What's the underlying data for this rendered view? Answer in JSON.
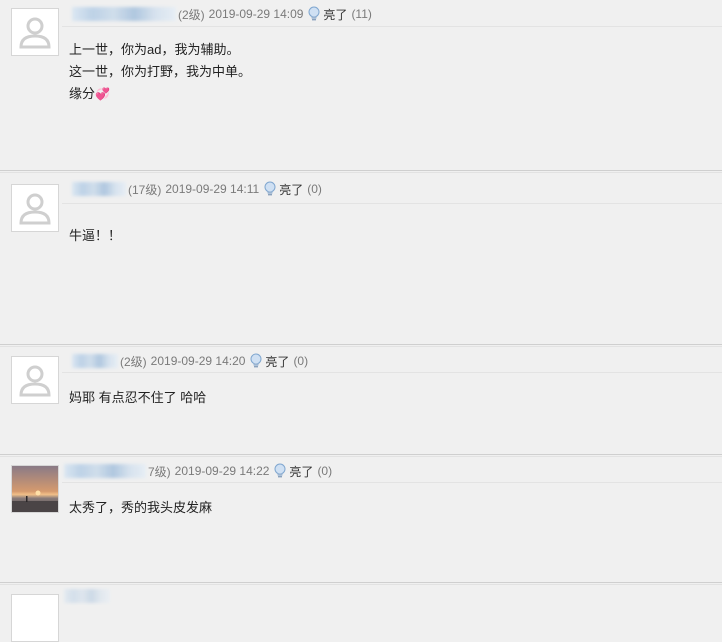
{
  "comments": [
    {
      "level": "(2级)",
      "time": "2019-09-29 14:09",
      "like_label": "亮了",
      "like_count": "(11)",
      "lines": [
        "上一世，你为ad，我为辅助。",
        "这一世，你为打野，我为中单。",
        "缘分"
      ],
      "emoji": "💞",
      "avatar": "default-avatar"
    },
    {
      "level": "(17级)",
      "time": "2019-09-29 14:11",
      "like_label": "亮了",
      "like_count": "(0)",
      "lines": [
        "牛逼！！"
      ],
      "avatar": "default-avatar"
    },
    {
      "level": "(2级)",
      "time": "2019-09-29 14:20",
      "like_label": "亮了",
      "like_count": "(0)",
      "lines": [
        "妈耶 有点忍不住了 哈哈"
      ],
      "avatar": "default-avatar"
    },
    {
      "level": "7级)",
      "time": "2019-09-29 14:22",
      "like_label": "亮了",
      "like_count": "(0)",
      "lines": [
        "太秀了，秀的我头皮发麻"
      ],
      "avatar": "sunset-photo-avatar"
    }
  ],
  "colors": {
    "background": "#f0f0f0",
    "meta_text": "#7a7a7a",
    "body_text": "#222222",
    "separator": "#cfcfcf"
  }
}
